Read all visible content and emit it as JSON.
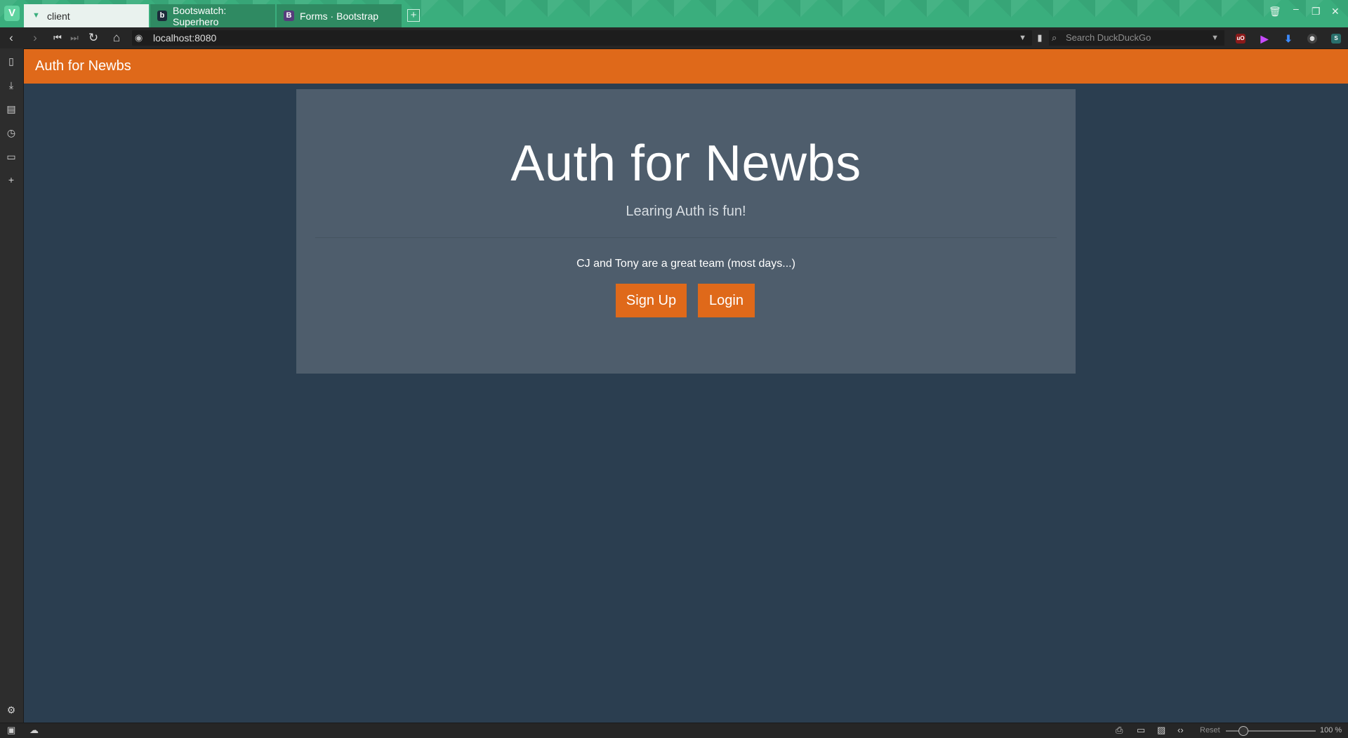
{
  "browser": {
    "tabs": [
      {
        "label": "client",
        "icon": "vue-icon",
        "active": true
      },
      {
        "label": "Bootswatch: Superhero",
        "icon": "bootswatch-icon",
        "active": false
      },
      {
        "label": "Forms · Bootstrap",
        "icon": "bootstrap-icon",
        "active": false
      }
    ],
    "url": "localhost:8080",
    "search_placeholder": "Search DuckDuckGo",
    "zoom_reset_label": "Reset",
    "zoom_level": "100 %"
  },
  "navbar": {
    "brand": "Auth for Newbs"
  },
  "jumbotron": {
    "title": "Auth for Newbs",
    "lead": "Learing Auth is fun!",
    "description": "CJ and Tony are a great team (most days...)",
    "signup_label": "Sign Up",
    "login_label": "Login"
  },
  "colors": {
    "brand_orange": "#df691a",
    "page_bg": "#2b3e50",
    "jumbotron_bg": "#4e5d6c",
    "tabbar_green": "#3aae7d"
  }
}
